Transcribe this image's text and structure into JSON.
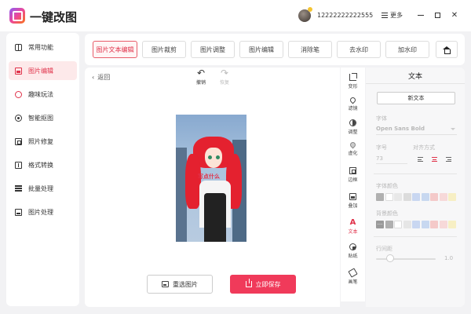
{
  "app": {
    "title": "一键改图",
    "phone": "12222222222555",
    "more_label": "更多",
    "window_controls": [
      "minimize-icon",
      "maximize-icon",
      "close-icon"
    ]
  },
  "sidebar": {
    "items": [
      {
        "label": "常用功能",
        "icon": "grid-icon",
        "active": false
      },
      {
        "label": "图片编辑",
        "icon": "image-edit-icon",
        "active": true
      },
      {
        "label": "趣味玩法",
        "icon": "fun-icon",
        "active": false
      },
      {
        "label": "智能抠图",
        "icon": "cutout-icon",
        "active": false
      },
      {
        "label": "照片修复",
        "icon": "photo-repair-icon",
        "active": false
      },
      {
        "label": "格式转换",
        "icon": "format-convert-icon",
        "active": false
      },
      {
        "label": "批量处理",
        "icon": "batch-icon",
        "active": false
      },
      {
        "label": "图片处理",
        "icon": "image-process-icon",
        "active": false
      }
    ]
  },
  "tools": {
    "tabs": [
      {
        "label": "图片文本编辑",
        "active": true
      },
      {
        "label": "图片裁剪",
        "active": false
      },
      {
        "label": "图片调整",
        "active": false
      },
      {
        "label": "图片编辑",
        "active": false
      },
      {
        "label": "消除笔",
        "active": false
      },
      {
        "label": "去水印",
        "active": false
      },
      {
        "label": "加水印",
        "active": false
      }
    ],
    "home_icon": "home-icon"
  },
  "canvas": {
    "back_label": "返回",
    "undo_label": "撤销",
    "redo_label": "恢复",
    "photo_caption": "写点什么",
    "reselect_label": "重选图片",
    "save_label": "立即保存"
  },
  "vertical_tools": [
    {
      "label": "变形",
      "icon": "crop-icon",
      "active": false
    },
    {
      "label": "滤镜",
      "icon": "filter-icon",
      "active": false
    },
    {
      "label": "调整",
      "icon": "adjust-icon",
      "active": false
    },
    {
      "label": "虚化",
      "icon": "blur-icon",
      "active": false
    },
    {
      "label": "边框",
      "icon": "frame-icon",
      "active": false
    },
    {
      "label": "叠加",
      "icon": "overlay-icon",
      "active": false
    },
    {
      "label": "文本",
      "icon": "text-icon",
      "active": true
    },
    {
      "label": "贴纸",
      "icon": "sticker-icon",
      "active": false
    },
    {
      "label": "画笔",
      "icon": "brush-icon",
      "active": false
    }
  ],
  "text_panel": {
    "title": "文本",
    "new_text_label": "新文本",
    "font_label": "字体",
    "font_value": "Open Sans Bold",
    "size_label": "字号",
    "size_value": "73",
    "align_label": "对齐方式",
    "font_color_label": "字体颜色",
    "bg_color_label": "背景颜色",
    "line_spacing_label": "行间距",
    "line_spacing_value": "1.0",
    "font_colors": [
      "#b0b0b0",
      "#ffffff",
      "#e8e8e8",
      "#dcdcdc",
      "#c9d7f1",
      "#c8d8f0",
      "#f4c9c9",
      "#f7d9d9",
      "#f7efc4"
    ],
    "bg_colors": [
      "#9a9a9a",
      "#b0b0b0",
      "#ffffff",
      "#e6e6e6",
      "#c9d7f1",
      "#c8d8f0",
      "#f4c9c9",
      "#f7d9d9",
      "#f7efc4"
    ]
  },
  "colors": {
    "accent": "#e0324a",
    "save_button": "#f03a5a",
    "active_bg": "#fde9ea"
  }
}
